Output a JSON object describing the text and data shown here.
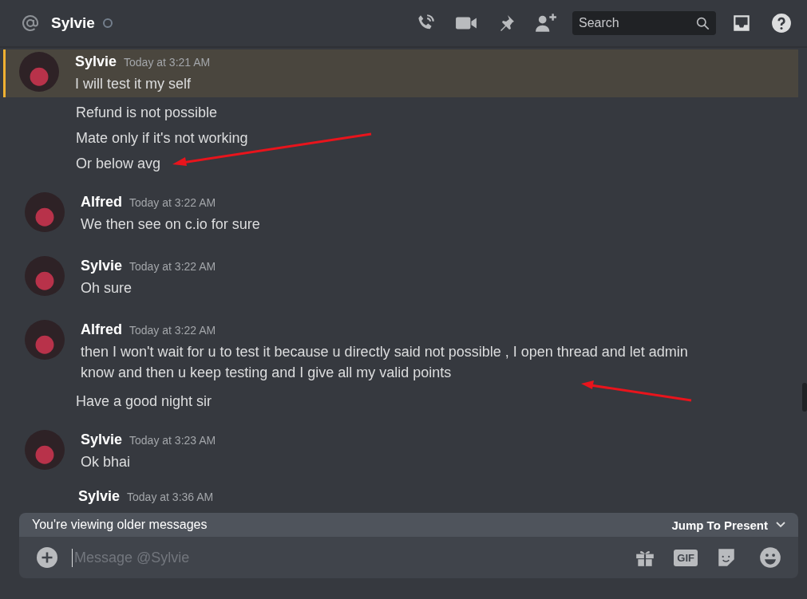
{
  "header": {
    "channel_name": "Sylvie",
    "search": {
      "placeholder": "Search"
    }
  },
  "messages": [
    {
      "author": "Sylvie",
      "timestamp": "Today at 3:21 AM",
      "highlighted": true,
      "lines": [
        "I will test it my self",
        "Refund is not possible",
        "Mate only if it's not working",
        "Or below avg"
      ]
    },
    {
      "author": "Alfred",
      "timestamp": "Today at 3:22 AM",
      "highlighted": false,
      "lines": [
        "We then see on c.io for sure"
      ]
    },
    {
      "author": "Sylvie",
      "timestamp": "Today at 3:22 AM",
      "highlighted": false,
      "lines": [
        "Oh sure"
      ]
    },
    {
      "author": "Alfred",
      "timestamp": "Today at 3:22 AM",
      "highlighted": false,
      "lines": [
        "then I won't wait for u to test it because u directly said not possible , I open thread and let admin know and then u keep testing and I give all my valid points",
        "Have a good night sir"
      ]
    },
    {
      "author": "Sylvie",
      "timestamp": "Today at 3:23 AM",
      "highlighted": false,
      "lines": [
        "Ok bhai"
      ]
    }
  ],
  "partly_hidden_message": {
    "author": "Sylvie",
    "timestamp": "Today at 3:36 AM"
  },
  "older_messages_bar": {
    "text": "You're viewing older messages",
    "jump_label": "Jump To Present"
  },
  "composer": {
    "placeholder": "Message @Sylvie",
    "gif_label": "GIF"
  }
}
